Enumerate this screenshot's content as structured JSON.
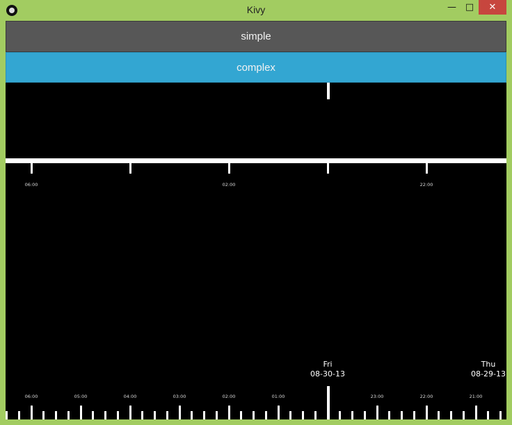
{
  "window": {
    "title": "Kivy",
    "min_glyph": "—",
    "max_glyph": "□",
    "close_glyph": "✕"
  },
  "buttons": {
    "simple": "simple",
    "complex": "complex"
  },
  "timeline_simple": {
    "hour_labels": [
      "06:00",
      "02:00",
      "22:00"
    ]
  },
  "timeline_complex": {
    "hour_labels": [
      "06:00",
      "05:00",
      "04:00",
      "03:00",
      "02:00",
      "01:00",
      "23:00",
      "22:00",
      "21:00"
    ],
    "day_markers": [
      {
        "weekday": "Fri",
        "date": "08-30-13"
      },
      {
        "weekday": "Thu",
        "date": "08-29-13"
      }
    ]
  },
  "colors": {
    "accent": "#33a6d2",
    "frame": "#a2cc61",
    "close": "#c7463e"
  }
}
